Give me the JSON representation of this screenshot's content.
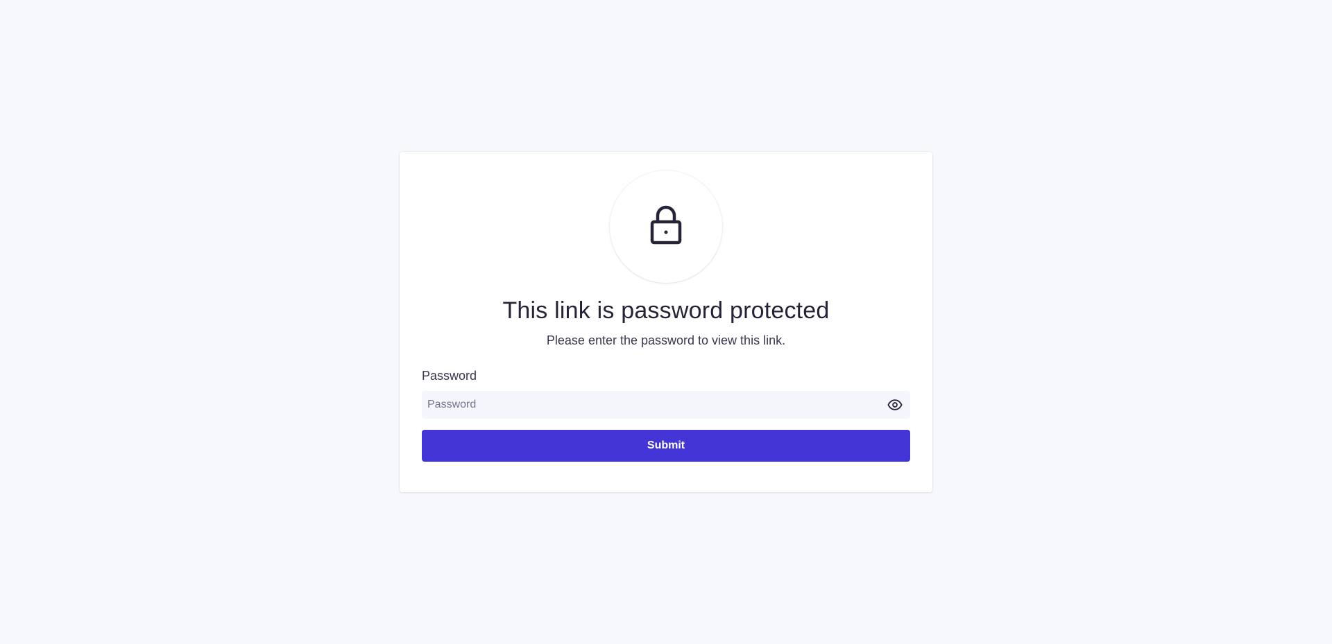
{
  "page": {
    "title": "This link is password protected",
    "subtitle": "Please enter the password to view this link.",
    "lock_icon": "lock-icon"
  },
  "form": {
    "password_label": "Password",
    "password_placeholder": "Password",
    "password_value": "",
    "toggle_icon": "eye-icon",
    "submit_label": "Submit"
  },
  "colors": {
    "background": "#f7f8fc",
    "card": "#ffffff",
    "text": "#262338",
    "input_background": "#f5f6fb",
    "accent": "#4335d6"
  }
}
